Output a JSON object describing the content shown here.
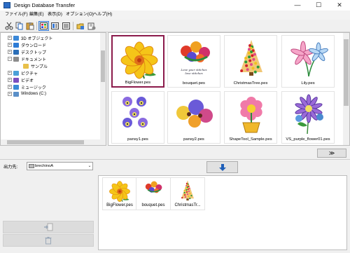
{
  "window": {
    "title": "Design Database Transfer",
    "controls": [
      "—",
      "☐",
      "✕"
    ]
  },
  "menu": [
    {
      "label": "ファイル(F)"
    },
    {
      "label": "編集(E)"
    },
    {
      "label": "表示(D)"
    },
    {
      "label": "オプション(O)"
    },
    {
      "label": "ヘルプ(H)"
    }
  ],
  "toolbar": {
    "icons": [
      "cut-icon",
      "copy-icon",
      "paste-icon",
      "large-thumbnail-icon",
      "medium-thumbnail-icon",
      "list-view-icon",
      "folder-icon",
      "properties-icon"
    ]
  },
  "tree": {
    "items": [
      {
        "label": "3D オブジェクト",
        "indent": 1,
        "color": "#3b88d8"
      },
      {
        "label": "ダウンロード",
        "indent": 1,
        "color": "#2c7bd6"
      },
      {
        "label": "デスクトップ",
        "indent": 1,
        "color": "#2c6fb8"
      },
      {
        "label": "ドキュメント",
        "indent": 1,
        "color": "#8c8c8c"
      },
      {
        "label": "サンプル",
        "indent": 2,
        "color": "#e8c04a"
      },
      {
        "label": "ピクチャ",
        "indent": 1,
        "color": "#4aa0d8"
      },
      {
        "label": "ビデオ",
        "indent": 1,
        "color": "#7a4fc0"
      },
      {
        "label": "ミュージック",
        "indent": 1,
        "color": "#3a8ad6"
      },
      {
        "label": "Windows (C:)",
        "indent": 1,
        "color": "#5a8fc8"
      }
    ]
  },
  "gallery": {
    "items": [
      {
        "name": "BigFlower.pes",
        "selected": true
      },
      {
        "name": "bouquet.pes",
        "selected": false
      },
      {
        "name": "ChristmasTree.pes",
        "selected": false
      },
      {
        "name": "Lily.pes",
        "selected": false
      },
      {
        "name": "pansy1.pes",
        "selected": false
      },
      {
        "name": "pansy2.pes",
        "selected": false
      },
      {
        "name": "ShapeTool_Sample.pes",
        "selected": false
      },
      {
        "name": "VS_purple_flower01.pes",
        "selected": false
      }
    ],
    "bouquet_caption_line1": "Love your stitches",
    "bouquet_caption_line2": "love stitches"
  },
  "collapse_button_label": "≫",
  "output": {
    "label": "出力先:",
    "selected": "brechinoA"
  },
  "destination": {
    "items": [
      {
        "name": "BigFlower.pes"
      },
      {
        "name": "bouquet.pes"
      },
      {
        "name": "ChristmasTr..."
      }
    ]
  },
  "colors": {
    "accent": "#1f5fb8",
    "selection_border": "#8b1a4b"
  }
}
